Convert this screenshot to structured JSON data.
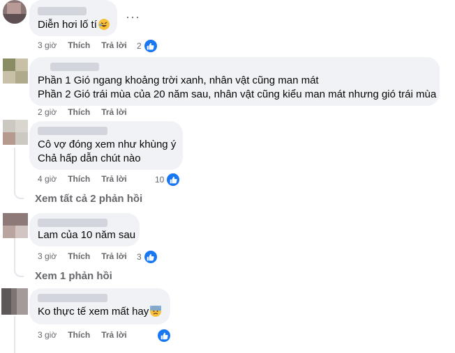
{
  "comments": [
    {
      "lines": [
        "Diễn hơi lố tí"
      ],
      "emoji": "rolling-on-floor-laughing",
      "time": "3 giờ",
      "like": "Thích",
      "reply": "Trả lời",
      "reactions": "2"
    },
    {
      "lines": [
        "Phần 1 Gió ngang khoảng trời xanh, nhân vật cũng man mát",
        "Phần 2 Gió trái mùa của 20 năm sau, nhân vật cũng kiểu man mát nhưng gió trái mùa"
      ],
      "time": "2 giờ",
      "like": "Thích",
      "reply": "Trả lời"
    },
    {
      "lines": [
        "Cô vợ đóng xem như khùng ý",
        "Chả hấp dẫn chút nào"
      ],
      "time": "4 giờ",
      "like": "Thích",
      "reply": "Trả lời",
      "reactions": "10",
      "view_replies": "Xem tất cả 2 phản hồi"
    },
    {
      "lines": [
        "Lam của 10 năm sau"
      ],
      "time": "3 giờ",
      "like": "Thích",
      "reply": "Trả lời",
      "reactions": "3",
      "view_replies": "Xem 1 phản hồi"
    },
    {
      "lines": [
        "Ko thực tế xem mất hay"
      ],
      "emoji": "anxious-face-with-sweat",
      "time": "3 giờ",
      "like": "Thích",
      "reply": "Trả lời",
      "reactions": ""
    }
  ],
  "more_options": "···",
  "colors": {
    "like_blue": "#1877f2",
    "bubble": "#f0f2f5",
    "meta_gray": "#65676b"
  }
}
